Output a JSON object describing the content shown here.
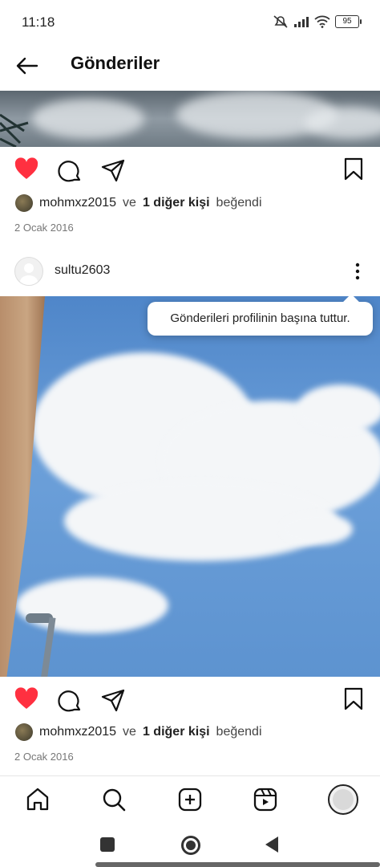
{
  "status": {
    "time": "11:18",
    "battery": "95"
  },
  "header": {
    "title": "Gönderiler"
  },
  "posts": [
    {
      "likes": {
        "user": "mohmxz2015",
        "connector": "ve",
        "others": "1 diğer kişi",
        "suffix": "beğendi"
      },
      "date": "2 Ocak 2016"
    },
    {
      "username": "sultu2603",
      "likes": {
        "user": "mohmxz2015",
        "connector": "ve",
        "others": "1 diğer kişi",
        "suffix": "beğendi"
      },
      "date": "2 Ocak 2016"
    }
  ],
  "tooltip": {
    "text": "Gönderileri profilinin başına tuttur."
  },
  "icons": {
    "back": "arrow-left-icon",
    "like": "heart-filled-icon",
    "comment": "comment-icon",
    "share": "send-icon",
    "save": "bookmark-icon",
    "more": "more-vertical-icon",
    "home": "home-icon",
    "search": "search-icon",
    "create": "plus-square-icon",
    "reels": "reels-icon"
  },
  "colors": {
    "like_red": "#ff3040",
    "text": "#222222",
    "muted": "#777777"
  }
}
